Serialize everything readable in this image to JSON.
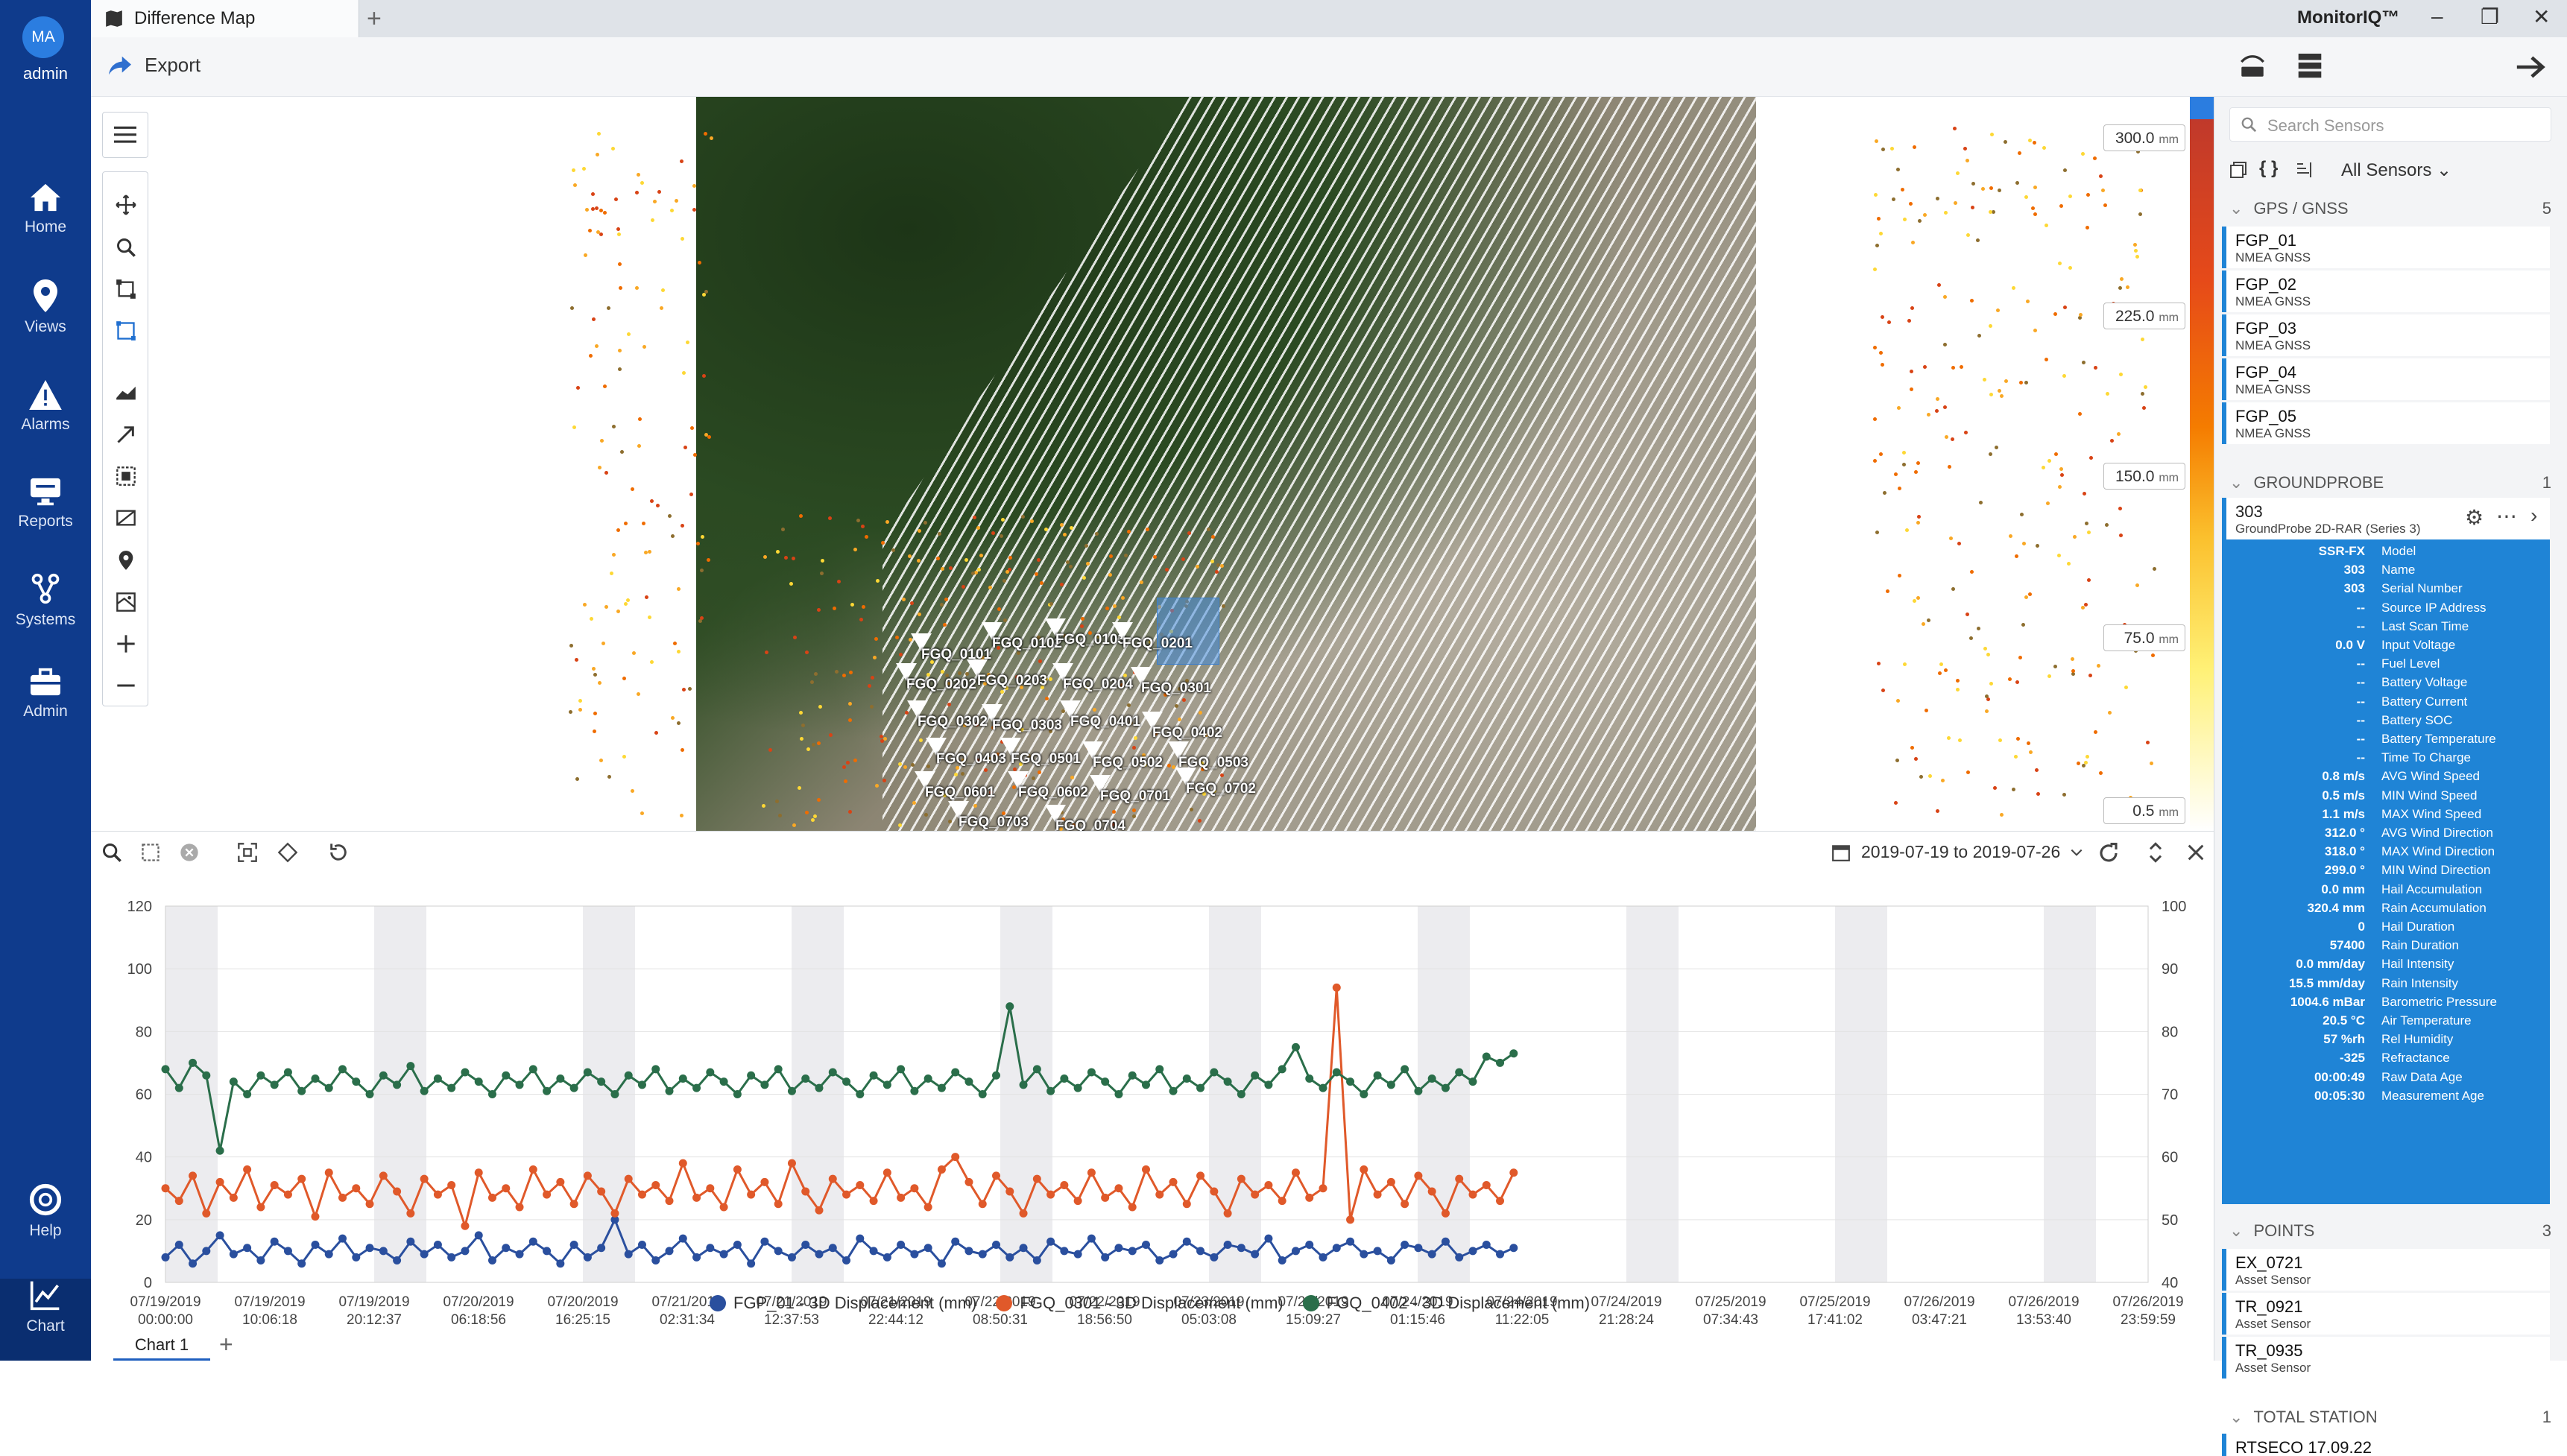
{
  "nav": {
    "avatar_initials": "MA",
    "user": "admin",
    "items": [
      {
        "label": "Home",
        "icon": "home-icon"
      },
      {
        "label": "Views",
        "icon": "map-pin-icon"
      },
      {
        "label": "Alarms",
        "icon": "warning-icon"
      },
      {
        "label": "Reports",
        "icon": "monitor-icon"
      },
      {
        "label": "Systems",
        "icon": "network-icon"
      },
      {
        "label": "Admin",
        "icon": "toolbox-icon"
      }
    ],
    "help": "Help",
    "chart": "Chart"
  },
  "tabbar": {
    "tab_title": "Difference Map",
    "brand": "MonitorIQ™"
  },
  "toolbar": {
    "export_label": "Export"
  },
  "map": {
    "scale_labels": [
      {
        "value": "300.0",
        "unit": "mm"
      },
      {
        "value": "225.0",
        "unit": "mm"
      },
      {
        "value": "150.0",
        "unit": "mm"
      },
      {
        "value": "75.0",
        "unit": "mm"
      },
      {
        "value": "0.5",
        "unit": "mm"
      }
    ],
    "sensor_labels": [
      "FGQ_0101",
      "FGQ_0102",
      "FGQ_0103",
      "FGQ_0201",
      "FGQ_0202",
      "FGQ_0203",
      "FGQ_0204",
      "FGQ_0301",
      "FGQ_0302",
      "FGQ_0303",
      "FGQ_0401",
      "FGQ_0402",
      "FGQ_0403",
      "FGQ_0501",
      "FGQ_0502",
      "FGQ_0503",
      "FGQ_0601",
      "FGQ_0602",
      "FGQ_0701",
      "FGQ_0702",
      "FGQ_0703",
      "FGQ_0704"
    ]
  },
  "chart_panel": {
    "date_range": "2019-07-19 to 2019-07-26",
    "tab": "Chart 1"
  },
  "chart_data": {
    "type": "line",
    "x_tick_labels": [
      [
        "07/19/2019",
        "00:00:00"
      ],
      [
        "07/19/2019",
        "10:06:18"
      ],
      [
        "07/19/2019",
        "20:12:37"
      ],
      [
        "07/20/2019",
        "06:18:56"
      ],
      [
        "07/20/2019",
        "16:25:15"
      ],
      [
        "07/21/2019",
        "02:31:34"
      ],
      [
        "07/21/2019",
        "12:37:53"
      ],
      [
        "07/21/2019",
        "22:44:12"
      ],
      [
        "07/22/2019",
        "08:50:31"
      ],
      [
        "07/22/2019",
        "18:56:50"
      ],
      [
        "07/23/2019",
        "05:03:08"
      ],
      [
        "07/23/2019",
        "15:09:27"
      ],
      [
        "07/24/2019",
        "01:15:46"
      ],
      [
        "07/24/2019",
        "11:22:05"
      ],
      [
        "07/24/2019",
        "21:28:24"
      ],
      [
        "07/25/2019",
        "07:34:43"
      ],
      [
        "07/25/2019",
        "17:41:02"
      ],
      [
        "07/26/2019",
        "03:47:21"
      ],
      [
        "07/26/2019",
        "13:53:40"
      ],
      [
        "07/26/2019",
        "23:59:59"
      ]
    ],
    "y_left": {
      "min": 0,
      "max": 120,
      "ticks": [
        0,
        20,
        40,
        60,
        80,
        100,
        120
      ]
    },
    "y_right": {
      "min": 40,
      "max": 100,
      "ticks": [
        40,
        50,
        60,
        70,
        80,
        90,
        100
      ]
    },
    "data_end_fraction": 0.68,
    "series": [
      {
        "name": "FGP_01 - 3D Displacement (mm)",
        "color": "#2a4f9e",
        "axis": "left",
        "values": [
          8,
          12,
          6,
          10,
          15,
          9,
          11,
          7,
          13,
          10,
          6,
          12,
          9,
          14,
          8,
          11,
          10,
          7,
          13,
          9,
          12,
          8,
          10,
          15,
          7,
          11,
          9,
          13,
          10,
          6,
          12,
          8,
          11,
          20,
          9,
          12,
          7,
          10,
          14,
          8,
          11,
          9,
          12,
          6,
          13,
          10,
          8,
          12,
          9,
          11,
          7,
          14,
          10,
          8,
          12,
          9,
          11,
          6,
          13,
          10,
          9,
          12,
          8,
          11,
          7,
          13,
          10,
          9,
          14,
          8,
          11,
          10,
          12,
          7,
          9,
          13,
          10,
          8,
          12,
          11,
          9,
          14,
          7,
          10,
          12,
          8,
          11,
          13,
          9,
          10,
          7,
          12,
          11,
          9,
          13,
          8,
          10,
          12,
          9,
          11
        ]
      },
      {
        "name": "FGQ_0301 - 3D Displacement (mm)",
        "color": "#e0592a",
        "axis": "left",
        "values": [
          30,
          26,
          34,
          22,
          32,
          27,
          36,
          24,
          31,
          28,
          33,
          21,
          35,
          27,
          30,
          25,
          34,
          29,
          22,
          33,
          28,
          31,
          18,
          35,
          27,
          30,
          24,
          36,
          28,
          32,
          25,
          34,
          29,
          22,
          33,
          28,
          31,
          26,
          38,
          27,
          30,
          24,
          36,
          28,
          32,
          25,
          38,
          29,
          23,
          33,
          28,
          31,
          26,
          35,
          27,
          30,
          24,
          36,
          40,
          32,
          25,
          34,
          29,
          22,
          33,
          28,
          31,
          26,
          35,
          27,
          30,
          24,
          36,
          28,
          32,
          25,
          34,
          29,
          22,
          33,
          28,
          31,
          26,
          35,
          27,
          30,
          94,
          20,
          36,
          28,
          32,
          25,
          34,
          29,
          22,
          33,
          28,
          31,
          26,
          35
        ]
      },
      {
        "name": "FGQ_0402 - 3D Displacement (mm)",
        "color": "#2a6e4a",
        "axis": "left",
        "values": [
          68,
          62,
          70,
          66,
          42,
          64,
          60,
          66,
          63,
          67,
          61,
          65,
          62,
          68,
          64,
          60,
          66,
          63,
          69,
          61,
          65,
          62,
          67,
          64,
          60,
          66,
          63,
          68,
          61,
          65,
          62,
          67,
          64,
          60,
          66,
          63,
          68,
          61,
          65,
          62,
          67,
          64,
          60,
          66,
          63,
          68,
          61,
          65,
          62,
          67,
          64,
          60,
          66,
          63,
          68,
          61,
          65,
          62,
          67,
          64,
          60,
          66,
          88,
          63,
          68,
          61,
          65,
          62,
          67,
          64,
          60,
          66,
          63,
          68,
          61,
          65,
          62,
          67,
          64,
          60,
          66,
          63,
          68,
          75,
          65,
          62,
          67,
          64,
          60,
          66,
          63,
          68,
          61,
          65,
          62,
          67,
          64,
          72,
          70,
          73
        ]
      }
    ]
  },
  "right_panel": {
    "search_placeholder": "Search Sensors",
    "filter_label": "All Sensors",
    "sections": {
      "gps": {
        "title": "GPS / GNSS",
        "count": "5",
        "items": [
          {
            "name": "FGP_01",
            "type": "NMEA GNSS"
          },
          {
            "name": "FGP_02",
            "type": "NMEA GNSS"
          },
          {
            "name": "FGP_03",
            "type": "NMEA GNSS"
          },
          {
            "name": "FGP_04",
            "type": "NMEA GNSS"
          },
          {
            "name": "FGP_05",
            "type": "NMEA GNSS"
          }
        ]
      },
      "groundprobe": {
        "title": "GROUNDPROBE",
        "count": "1",
        "item": {
          "name": "303",
          "type": "GroundProbe 2D-RAR (Series 3)"
        },
        "rows": [
          {
            "v": "SSR-FX",
            "k": "Model"
          },
          {
            "v": "303",
            "k": "Name"
          },
          {
            "v": "303",
            "k": "Serial Number"
          },
          {
            "v": "--",
            "k": "Source IP Address"
          },
          {
            "v": "--",
            "k": "Last Scan Time"
          },
          {
            "v": "0.0 V",
            "k": "Input Voltage"
          },
          {
            "v": "--",
            "k": "Fuel Level"
          },
          {
            "v": "--",
            "k": "Battery Voltage"
          },
          {
            "v": "--",
            "k": "Battery Current"
          },
          {
            "v": "--",
            "k": "Battery SOC"
          },
          {
            "v": "--",
            "k": "Battery Temperature"
          },
          {
            "v": "--",
            "k": "Time To Charge"
          },
          {
            "v": "0.8 m/s",
            "k": "AVG Wind Speed"
          },
          {
            "v": "0.5 m/s",
            "k": "MIN Wind Speed"
          },
          {
            "v": "1.1 m/s",
            "k": "MAX Wind Speed"
          },
          {
            "v": "312.0 °",
            "k": "AVG Wind Direction"
          },
          {
            "v": "318.0 °",
            "k": "MAX Wind Direction"
          },
          {
            "v": "299.0 °",
            "k": "MIN Wind Direction"
          },
          {
            "v": "0.0 mm",
            "k": "Hail Accumulation"
          },
          {
            "v": "320.4 mm",
            "k": "Rain Accumulation"
          },
          {
            "v": "0",
            "k": "Hail Duration"
          },
          {
            "v": "57400",
            "k": "Rain Duration"
          },
          {
            "v": "0.0 mm/day",
            "k": "Hail Intensity"
          },
          {
            "v": "15.5 mm/day",
            "k": "Rain Intensity"
          },
          {
            "v": "1004.6 mBar",
            "k": "Barometric Pressure"
          },
          {
            "v": "20.5 °C",
            "k": "Air Temperature"
          },
          {
            "v": "57 %rh",
            "k": "Rel Humidity"
          },
          {
            "v": "-325",
            "k": "Refractance"
          },
          {
            "v": "00:00:49",
            "k": "Raw Data Age"
          },
          {
            "v": "00:05:30",
            "k": "Measurement Age"
          }
        ]
      },
      "points": {
        "title": "POINTS",
        "count": "3",
        "items": [
          {
            "name": "EX_0721",
            "type": "Asset Sensor"
          },
          {
            "name": "TR_0921",
            "type": "Asset Sensor"
          },
          {
            "name": "TR_0935",
            "type": "Asset Sensor"
          }
        ]
      },
      "total_station": {
        "title": "TOTAL STATION",
        "count": "1",
        "partial_item": "RTSECO 17.09.22"
      }
    }
  }
}
